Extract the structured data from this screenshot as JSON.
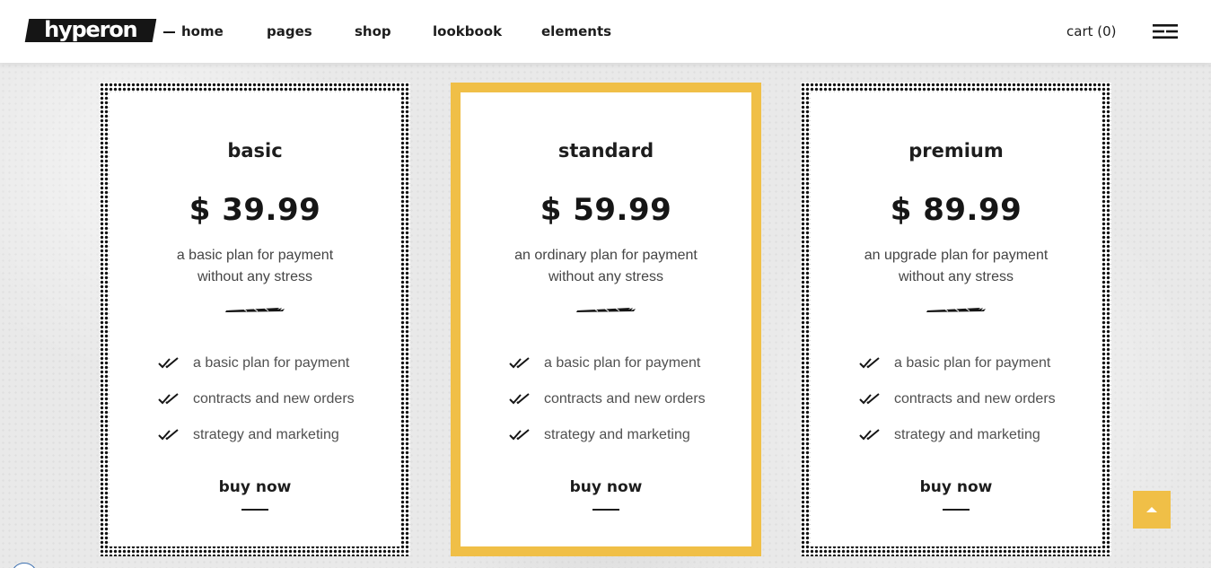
{
  "brand": {
    "logo_text": "hyperon"
  },
  "nav": {
    "items": [
      {
        "label": "home",
        "active": true
      },
      {
        "label": "pages"
      },
      {
        "label": "shop"
      },
      {
        "label": "lookbook"
      },
      {
        "label": "elements"
      }
    ],
    "cart_label": "cart",
    "cart_count": "(0)",
    "menu_icon": "hamburger-menu-icon"
  },
  "pricing": {
    "plans": [
      {
        "title": "basic",
        "price": "$ 39.99",
        "desc_line1": "a basic plan for payment",
        "desc_line2": "without any stress",
        "features": [
          "a basic plan for payment",
          "contracts and new orders",
          "strategy and marketing"
        ],
        "cta": "buy now",
        "style": "dotted-border"
      },
      {
        "title": "standard",
        "price": "$ 59.99",
        "desc_line1": "an ordinary plan for payment",
        "desc_line2": "without any stress",
        "features": [
          "a basic plan for payment",
          "contracts and new orders",
          "strategy and marketing"
        ],
        "cta": "buy now",
        "style": "featured-yellow-border"
      },
      {
        "title": "premium",
        "price": "$ 89.99",
        "desc_line1": "an upgrade plan for payment",
        "desc_line2": "without any stress",
        "features": [
          "a basic plan for payment",
          "contracts and new orders",
          "strategy and marketing"
        ],
        "cta": "buy now",
        "style": "dotted-border"
      }
    ]
  },
  "colors": {
    "accent": "#f0bf47",
    "text_dark": "#1d1d1d",
    "text_muted": "#505050",
    "background": "#e9e9e9"
  },
  "icons": {
    "feature_check": "double-check-icon",
    "divider": "brush-stroke-icon",
    "scroll_top": "arrow-up-icon"
  }
}
